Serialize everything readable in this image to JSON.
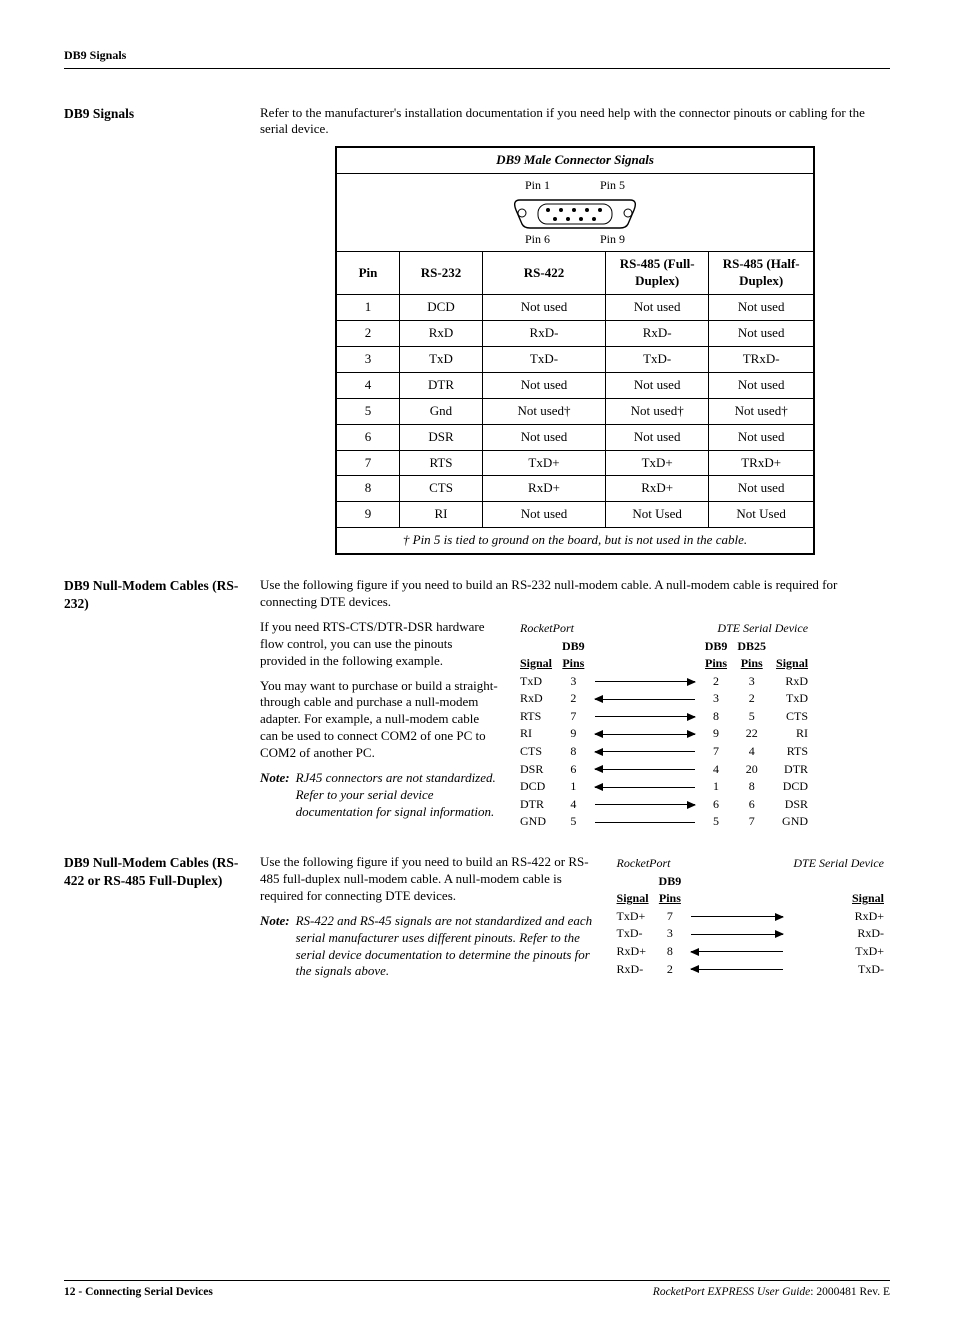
{
  "header": {
    "title": "DB9 Signals"
  },
  "section1": {
    "heading": "DB9 Signals",
    "intro": "Refer to the manufacturer's installation documentation if you need help with the connector pinouts or cabling for the serial device."
  },
  "table": {
    "title": "DB9 Male Connector Signals",
    "pin1": "Pin 1",
    "pin5": "Pin 5",
    "pin6": "Pin 6",
    "pin9": "Pin 9",
    "hdr": {
      "pin": "Pin",
      "rs232": "RS-232",
      "rs422": "RS-422",
      "rs485f": "RS-485 (Full-Duplex)",
      "rs485h": "RS-485 (Half-Duplex)"
    },
    "rows": [
      {
        "pin": "1",
        "rs232": "DCD",
        "rs422": "Not used",
        "rs485f": "Not used",
        "rs485h": "Not used"
      },
      {
        "pin": "2",
        "rs232": "RxD",
        "rs422": "RxD-",
        "rs485f": "RxD-",
        "rs485h": "Not used"
      },
      {
        "pin": "3",
        "rs232": "TxD",
        "rs422": "TxD-",
        "rs485f": "TxD-",
        "rs485h": "TRxD-"
      },
      {
        "pin": "4",
        "rs232": "DTR",
        "rs422": "Not used",
        "rs485f": "Not used",
        "rs485h": "Not used"
      },
      {
        "pin": "5",
        "rs232": "Gnd",
        "rs422": "Not used†",
        "rs485f": "Not used†",
        "rs485h": "Not used†"
      },
      {
        "pin": "6",
        "rs232": "DSR",
        "rs422": "Not used",
        "rs485f": "Not used",
        "rs485h": "Not used"
      },
      {
        "pin": "7",
        "rs232": "RTS",
        "rs422": "TxD+",
        "rs485f": "TxD+",
        "rs485h": "TRxD+"
      },
      {
        "pin": "8",
        "rs232": "CTS",
        "rs422": "RxD+",
        "rs485f": "RxD+",
        "rs485h": "Not used"
      },
      {
        "pin": "9",
        "rs232": "RI",
        "rs422": "Not used",
        "rs485f": "Not Used",
        "rs485h": "Not Used"
      }
    ],
    "footnote": "† Pin 5 is tied to ground on the board, but is not used in the cable."
  },
  "section2": {
    "heading": "DB9 Null-Modem Cables (RS-232)",
    "p1": "Use the following figure if you need to build an RS-232 null-modem cable. A null-modem cable is required for connecting DTE devices.",
    "p2": "If you need RTS-CTS/DTR-DSR hardware flow control, you can use the pinouts provided in the following example.",
    "p3": "You may want to purchase or build a straight-through cable and purchase a null-modem adapter. For example, a null-modem cable can be used to connect COM2 of one PC to COM2 of another PC.",
    "noteLabel": "Note:",
    "note": "RJ45 connectors are not standardized. Refer to your serial device documentation for signal information."
  },
  "diagram1": {
    "leftTitle": "RocketPort",
    "rightTitle": "DTE Serial Device",
    "hd": {
      "signal": "Signal",
      "db9pins": "DB9 Pins",
      "db9p": "DB9",
      "db25p": "DB25",
      "pins": "Pins"
    },
    "rows": [
      {
        "ls": "TxD",
        "lp": "3",
        "dir": "r",
        "rd9": "2",
        "rd25": "3",
        "rs": "RxD"
      },
      {
        "ls": "RxD",
        "lp": "2",
        "dir": "l",
        "rd9": "3",
        "rd25": "2",
        "rs": "TxD"
      },
      {
        "ls": "RTS",
        "lp": "7",
        "dir": "r",
        "rd9": "8",
        "rd25": "5",
        "rs": "CTS"
      },
      {
        "ls": "RI",
        "lp": "9",
        "dir": "b",
        "rd9": "9",
        "rd25": "22",
        "rs": "RI"
      },
      {
        "ls": "CTS",
        "lp": "8",
        "dir": "l",
        "rd9": "7",
        "rd25": "4",
        "rs": "RTS"
      },
      {
        "ls": "DSR",
        "lp": "6",
        "dir": "l",
        "rd9": "4",
        "rd25": "20",
        "rs": "DTR"
      },
      {
        "ls": "DCD",
        "lp": "1",
        "dir": "l",
        "rd9": "1",
        "rd25": "8",
        "rs": "DCD"
      },
      {
        "ls": "DTR",
        "lp": "4",
        "dir": "r",
        "rd9": "6",
        "rd25": "6",
        "rs": "DSR"
      },
      {
        "ls": "GND",
        "lp": "5",
        "dir": "n",
        "rd9": "5",
        "rd25": "7",
        "rs": "GND"
      }
    ]
  },
  "section3": {
    "heading": "DB9 Null-Modem Cables (RS-422 or RS-485 Full-Duplex)",
    "p1": "Use the following figure if you need to build an RS-422 or RS-485 full-duplex null-modem cable. A null-modem cable is required for connecting DTE devices.",
    "noteLabel": "Note:",
    "note": "RS-422 and RS-45 signals are not standardized and each serial manufacturer uses different pinouts. Refer to the serial device documentation to determine the pinouts for the signals above."
  },
  "diagram2": {
    "leftTitle": "RocketPort",
    "rightTitle": "DTE Serial Device",
    "hd": {
      "signal": "Signal",
      "db9pins": "DB9 Pins"
    },
    "rows": [
      {
        "ls": "TxD+",
        "lp": "7",
        "dir": "r",
        "rs": "RxD+"
      },
      {
        "ls": "TxD-",
        "lp": "3",
        "dir": "r",
        "rs": "RxD-"
      },
      {
        "ls": "RxD+",
        "lp": "8",
        "dir": "l",
        "rs": "TxD+"
      },
      {
        "ls": "RxD-",
        "lp": "2",
        "dir": "l",
        "rs": "TxD-"
      }
    ]
  },
  "footer": {
    "left": "12 - Connecting Serial Devices",
    "rightItalic": "RocketPort EXPRESS User Guide",
    "rightRest": ": 2000481 Rev. E"
  }
}
